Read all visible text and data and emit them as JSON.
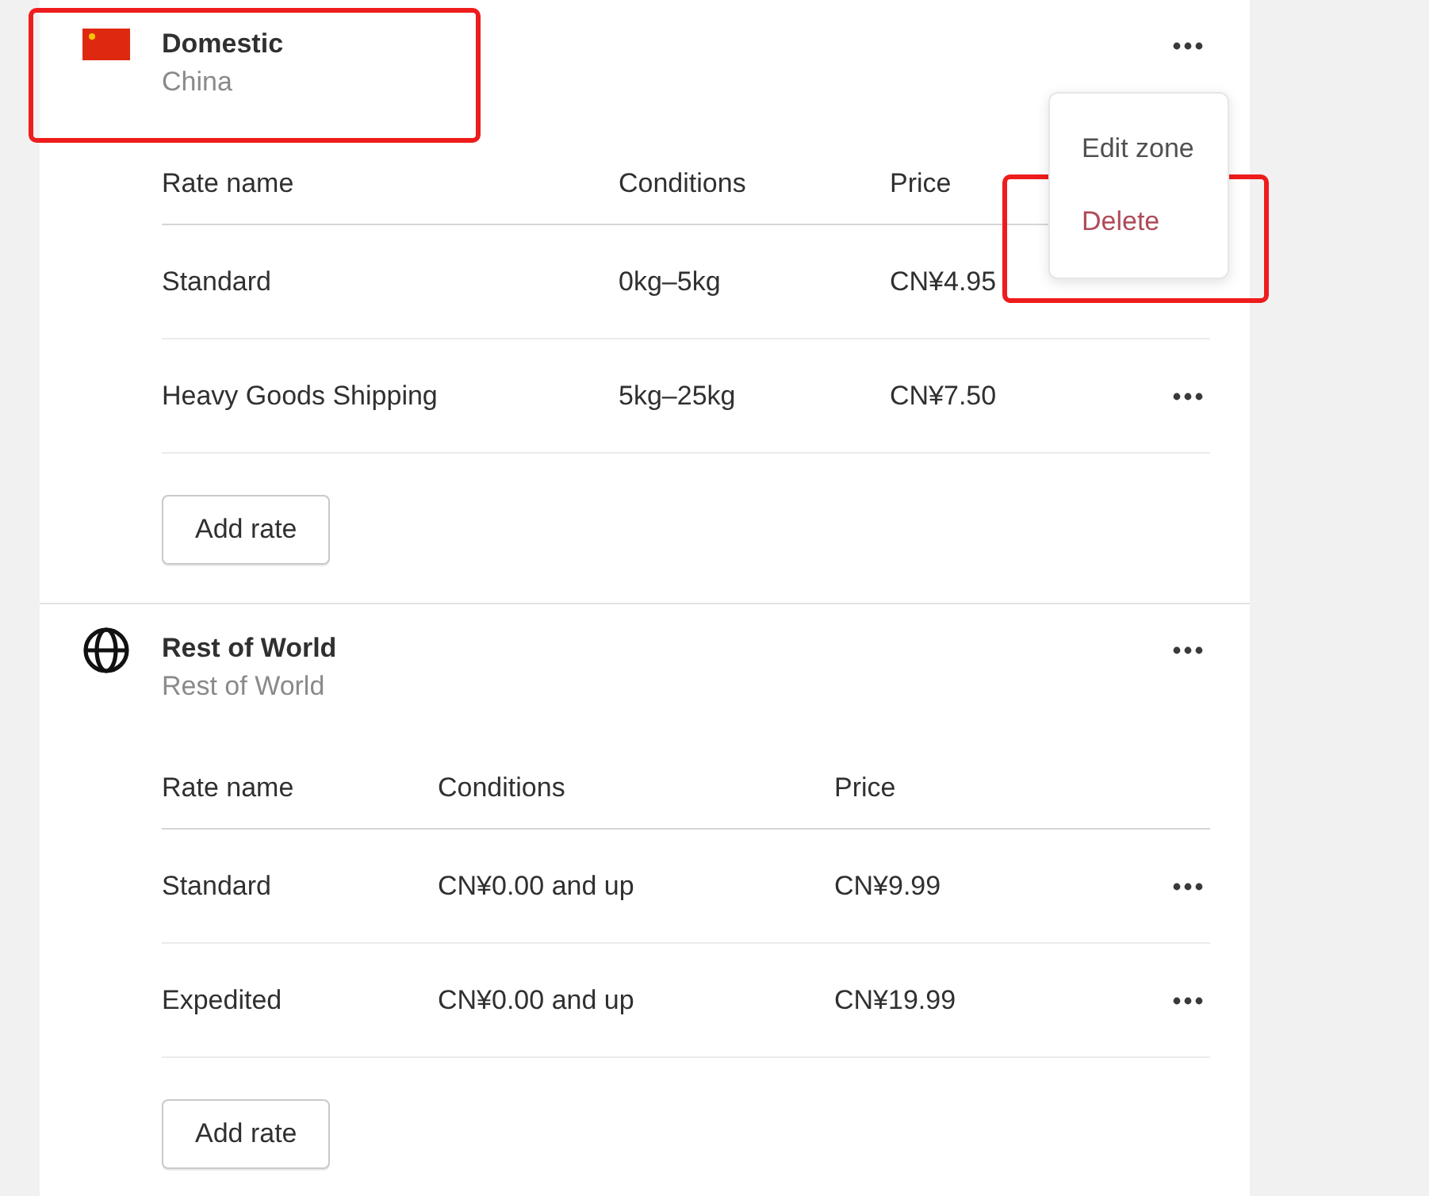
{
  "zones": [
    {
      "kind": "flag",
      "name": "Domestic",
      "region": "China",
      "highlighted": true,
      "menu": {
        "open": true,
        "items": [
          {
            "label": "Edit zone",
            "kind": "default",
            "highlighted": false
          },
          {
            "label": "Delete",
            "kind": "destructive",
            "highlighted": true
          }
        ]
      },
      "columns": [
        "Rate name",
        "Conditions",
        "Price"
      ],
      "rates": [
        {
          "name": "Standard",
          "conditions": "0kg–5kg",
          "price": "CN¥4.95",
          "actions": false
        },
        {
          "name": "Heavy Goods Shipping",
          "conditions": "5kg–25kg",
          "price": "CN¥7.50",
          "actions": true
        }
      ],
      "add_button": "Add rate"
    },
    {
      "kind": "globe",
      "name": "Rest of World",
      "region": "Rest of World",
      "highlighted": false,
      "columns": [
        "Rate name",
        "Conditions",
        "Price"
      ],
      "rates": [
        {
          "name": "Standard",
          "conditions": "CN¥0.00 and up",
          "price": "CN¥9.99",
          "actions": true
        },
        {
          "name": "Expedited",
          "conditions": "CN¥0.00 and up",
          "price": "CN¥19.99",
          "actions": true
        }
      ],
      "add_button": "Add rate"
    }
  ]
}
